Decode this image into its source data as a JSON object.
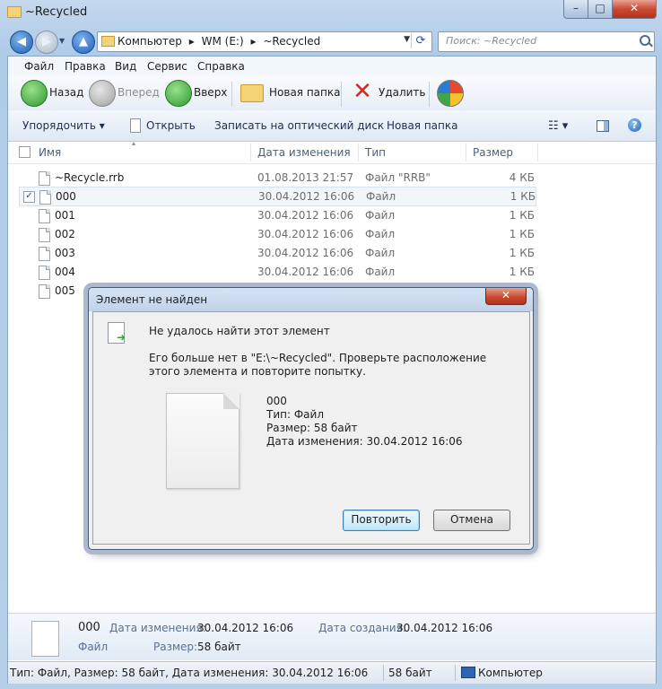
{
  "window": {
    "title": "~Recycled",
    "min_label": "–",
    "max_label": "□",
    "close_label": "✕"
  },
  "address": {
    "crumbs": [
      "Компьютер",
      "▸",
      "WM (E:)",
      "▸",
      "~Recycled"
    ],
    "prefix": "«",
    "dropdown": "▼",
    "refresh": "⟳"
  },
  "search": {
    "placeholder": "Поиск: ~Recycled"
  },
  "menu": [
    "Файл",
    "Правка",
    "Вид",
    "Сервис",
    "Справка"
  ],
  "toolbar1": {
    "back": "Назад",
    "forward": "Вперед",
    "up": "Вверх",
    "new_folder": "Новая папка",
    "delete": "Удалить"
  },
  "toolbar2": {
    "organize": "Упорядочить ▾",
    "open": "Открыть",
    "burn": "Записать на оптический диск",
    "new_folder": "Новая папка"
  },
  "columns": {
    "name": "Имя",
    "date": "Дата изменения",
    "type": "Тип",
    "size": "Размер"
  },
  "files": [
    {
      "name": "~Recycle.rrb",
      "date": "01.08.2013 21:57",
      "type": "Файл \"RRB\"",
      "size": "4 КБ",
      "checked": ""
    },
    {
      "name": "000",
      "date": "30.04.2012 16:06",
      "type": "Файл",
      "size": "1 КБ",
      "checked": "✓"
    },
    {
      "name": "001",
      "date": "30.04.2012 16:06",
      "type": "Файл",
      "size": "1 КБ",
      "checked": ""
    },
    {
      "name": "002",
      "date": "30.04.2012 16:06",
      "type": "Файл",
      "size": "1 КБ",
      "checked": ""
    },
    {
      "name": "003",
      "date": "30.04.2012 16:06",
      "type": "Файл",
      "size": "1 КБ",
      "checked": ""
    },
    {
      "name": "004",
      "date": "30.04.2012 16:06",
      "type": "Файл",
      "size": "1 КБ",
      "checked": ""
    },
    {
      "name": "005",
      "date": "",
      "type": "",
      "size": "",
      "checked": ""
    }
  ],
  "details": {
    "name": "000",
    "type": "Файл",
    "date_label": "Дата изменения:",
    "date_value": "30.04.2012 16:06",
    "size_label": "Размер:",
    "size_value": "58 байт",
    "created_label": "Дата создания:",
    "created_value": "30.04.2012 16:06"
  },
  "status": {
    "info": "Тип: Файл, Размер: 58 байт, Дата изменения: 30.04.2012 16:06",
    "size": "58 байт",
    "location": "Компьютер"
  },
  "dialog": {
    "title": "Элемент не найден",
    "close_label": "✕",
    "heading": "Не удалось найти этот элемент",
    "message": "Его больше нет в \"E:\\~Recycled\". Проверьте расположение этого элемента и повторите попытку.",
    "file_name": "000",
    "file_type": "Тип: Файл",
    "file_size": "Размер: 58 байт",
    "file_date": "Дата изменения: 30.04.2012 16:06",
    "retry": "Повторить",
    "cancel": "Отмена"
  },
  "colors": {
    "accent": "#3c7fb1",
    "close": "#c84b32",
    "window_frame": "#b6cfe9"
  }
}
